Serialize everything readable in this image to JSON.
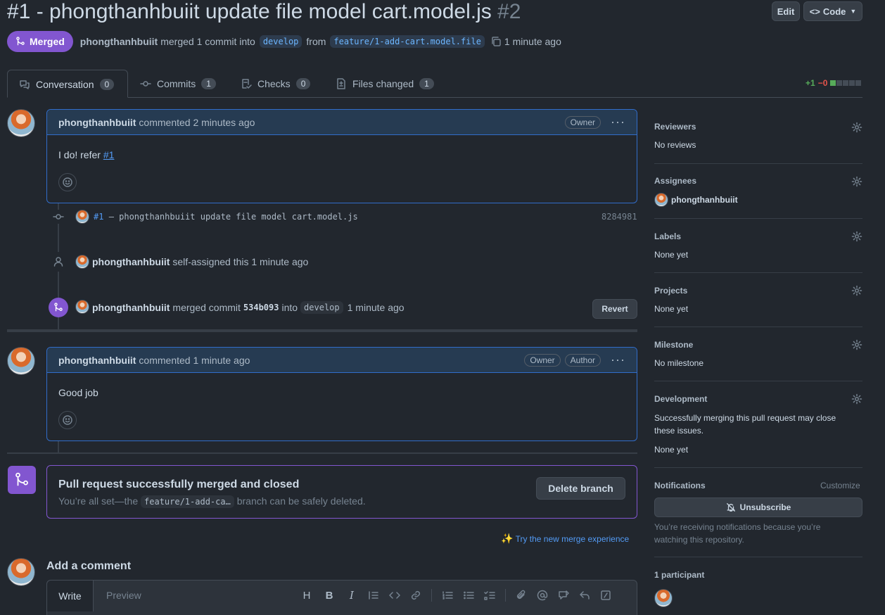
{
  "header": {
    "title": "#1 - phongthanhbuiit update file model cart.model.js",
    "number": "#2",
    "edit_label": "Edit",
    "code_label": "Code",
    "state_label": "Merged",
    "author": "phongthanhbuiit",
    "merged_text": "merged 1 commit into",
    "base_branch": "develop",
    "from_text": "from",
    "head_branch": "feature/1-add-cart.model.file",
    "time": "1 minute ago"
  },
  "tabs": [
    {
      "label": "Conversation",
      "count": "0"
    },
    {
      "label": "Commits",
      "count": "1"
    },
    {
      "label": "Checks",
      "count": "0"
    },
    {
      "label": "Files changed",
      "count": "1"
    }
  ],
  "diffstat": {
    "added": "+1",
    "removed": "−0"
  },
  "comment1": {
    "author": "phongthanhbuiit",
    "meta": "commented 2 minutes ago",
    "badge": "Owner",
    "body_prefix": "I do! refer ",
    "body_link": "#1"
  },
  "commit_event": {
    "ref": "#1",
    "message": "– phongthanhbuiit update file model cart.model.js",
    "sha": "8284981"
  },
  "assign_event": {
    "author": "phongthanhbuiit",
    "text": "self-assigned this 1 minute ago"
  },
  "merge_event": {
    "author": "phongthanhbuiit",
    "text1": "merged commit",
    "sha": "534b093",
    "text2": "into",
    "branch": "develop",
    "time": "1 minute ago",
    "revert_label": "Revert"
  },
  "comment2": {
    "author": "phongthanhbuiit",
    "meta": "commented 1 minute ago",
    "badge1": "Owner",
    "badge2": "Author",
    "body": "Good job"
  },
  "merged_box": {
    "title": "Pull request successfully merged and closed",
    "desc_prefix": "You’re all set—the",
    "branch": "feature/1-add-ca…",
    "desc_suffix": "branch can be safely deleted.",
    "delete_label": "Delete branch"
  },
  "try_merge": "Try the new merge experience",
  "add_comment": {
    "title": "Add a comment",
    "write_tab": "Write",
    "preview_tab": "Preview"
  },
  "sidebar": {
    "reviewers_title": "Reviewers",
    "reviewers_value": "No reviews",
    "assignees_title": "Assignees",
    "assignee": "phongthanhbuiit",
    "labels_title": "Labels",
    "labels_value": "None yet",
    "projects_title": "Projects",
    "projects_value": "None yet",
    "milestone_title": "Milestone",
    "milestone_value": "No milestone",
    "development_title": "Development",
    "development_desc": "Successfully merging this pull request may close these issues.",
    "development_value": "None yet",
    "notifications_title": "Notifications",
    "customize_label": "Customize",
    "unsubscribe_label": "Unsubscribe",
    "notifications_reason": "You’re receiving notifications because you’re watching this repository.",
    "participants_title": "1 participant"
  },
  "colors": {
    "merged": "#8256d0",
    "accent": "#539bf5",
    "added": "#57ab5a",
    "removed": "#e5534b"
  }
}
